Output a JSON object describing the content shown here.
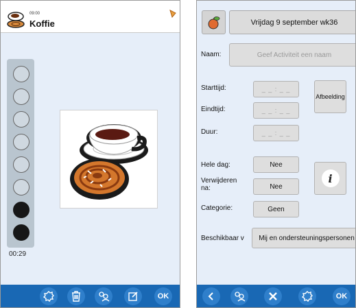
{
  "left_screen": {
    "header": {
      "time": "09:00",
      "title": "Koffie"
    },
    "timer": {
      "total_dots": 8,
      "filled_dots": 2,
      "remaining_label": "00:29"
    },
    "toolbar": {
      "ok_label": "OK",
      "icons": [
        "settings-icon",
        "trash-icon",
        "people-icon",
        "edit-icon"
      ]
    }
  },
  "right_screen": {
    "date_label": "Vrijdag 9 september wk36",
    "form": {
      "name_label": "Naam:",
      "name_placeholder": "Geef Activiteit een naam",
      "start_label": "Starttijd:",
      "start_value": "_ _ : _ _",
      "end_label": "Eindtijd:",
      "end_value": "_ _ : _ _",
      "duration_label": "Duur:",
      "duration_value": "_ _ : _ _",
      "image_label": "Afbeelding",
      "all_day_label": "Hele dag:",
      "all_day_value": "Nee",
      "remove_after_label": "Verwijderen na:",
      "remove_after_value": "Nee",
      "category_label": "Categorie:",
      "category_value": "Geen",
      "available_label": "Beschikbaar v",
      "available_value": "Mij en ondersteuningspersonen"
    },
    "toolbar": {
      "ok_label": "OK",
      "icons": [
        "back-icon",
        "people-icon",
        "tools-icon",
        "settings-icon"
      ]
    }
  },
  "colors": {
    "toolbar": "#1968b4",
    "background": "#e6eef9",
    "button": "#dedede"
  }
}
